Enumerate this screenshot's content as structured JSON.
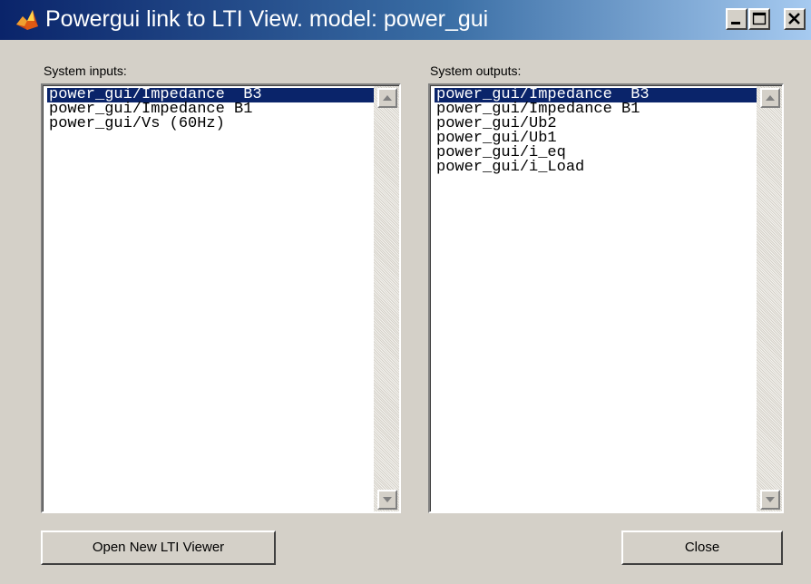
{
  "window": {
    "title": "Powergui link to LTI View. model: power_gui",
    "icon": "matlab-membrane-icon",
    "controls": [
      "minimize-icon",
      "maximize-icon",
      "close-icon"
    ]
  },
  "inputs": {
    "label": "System inputs:",
    "items": [
      "power_gui/Impedance  B3",
      "power_gui/Impedance B1",
      "power_gui/Vs (60Hz)"
    ],
    "selected_index": 0
  },
  "outputs": {
    "label": "System outputs:",
    "items": [
      "power_gui/Impedance  B3",
      "power_gui/Impedance B1",
      "power_gui/Ub2",
      "power_gui/Ub1",
      "power_gui/i_eq",
      "power_gui/i_Load"
    ],
    "selected_index": 0
  },
  "buttons": {
    "open_viewer": "Open New LTI Viewer",
    "close": "Close"
  },
  "colors": {
    "selection": "#0a246a",
    "title_gradient_start": "#0a246a",
    "title_gradient_end": "#a6caf0",
    "face": "#d4d0c8"
  }
}
